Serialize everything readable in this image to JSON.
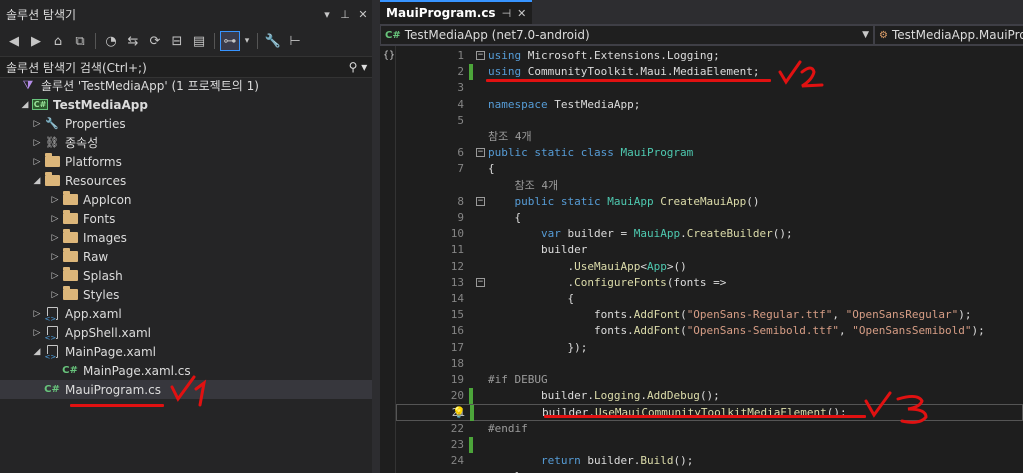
{
  "solution_explorer": {
    "title": "솔루션 탐색기",
    "search_placeholder": "솔루션 탐색기 검색(Ctrl+;)",
    "tree": [
      {
        "label": "솔루션 'TestMediaApp' (1 프로젝트의 1)",
        "icon": "solution-icon",
        "depth": 0,
        "arrow": ""
      },
      {
        "label": "TestMediaApp",
        "icon": "csproj-icon",
        "depth": 1,
        "arrow": "open",
        "bold": true
      },
      {
        "label": "Properties",
        "icon": "wrench-icon",
        "depth": 2,
        "arrow": "closed"
      },
      {
        "label": "종속성",
        "icon": "dependencies-icon",
        "depth": 2,
        "arrow": "closed"
      },
      {
        "label": "Platforms",
        "icon": "folder-icon",
        "depth": 2,
        "arrow": "closed"
      },
      {
        "label": "Resources",
        "icon": "folder-icon",
        "depth": 2,
        "arrow": "open"
      },
      {
        "label": "AppIcon",
        "icon": "folder-icon",
        "depth": 3,
        "arrow": "closed"
      },
      {
        "label": "Fonts",
        "icon": "folder-icon",
        "depth": 3,
        "arrow": "closed"
      },
      {
        "label": "Images",
        "icon": "folder-icon",
        "depth": 3,
        "arrow": "closed"
      },
      {
        "label": "Raw",
        "icon": "folder-icon",
        "depth": 3,
        "arrow": "closed"
      },
      {
        "label": "Splash",
        "icon": "folder-icon",
        "depth": 3,
        "arrow": "closed"
      },
      {
        "label": "Styles",
        "icon": "folder-icon",
        "depth": 3,
        "arrow": "closed"
      },
      {
        "label": "App.xaml",
        "icon": "xaml-icon",
        "depth": 2,
        "arrow": "closed"
      },
      {
        "label": "AppShell.xaml",
        "icon": "xaml-icon",
        "depth": 2,
        "arrow": "closed"
      },
      {
        "label": "MainPage.xaml",
        "icon": "xaml-icon",
        "depth": 2,
        "arrow": "open"
      },
      {
        "label": "MainPage.xaml.cs",
        "icon": "csharp-icon",
        "depth": 3,
        "arrow": ""
      },
      {
        "label": "MauiProgram.cs",
        "icon": "csharp-icon",
        "depth": 2,
        "arrow": "",
        "selected": true
      }
    ],
    "annotation": "✓1"
  },
  "editor": {
    "tab_label": "MauiProgram.cs",
    "nav_project": "TestMediaApp (net7.0-android)",
    "nav_class": "TestMediaApp.MauiProgram",
    "lines": [
      {
        "n": "1",
        "tokens": [
          [
            "kw",
            "using"
          ],
          [
            "tx",
            " Microsoft.Extensions.Logging;"
          ]
        ],
        "fold": "−"
      },
      {
        "n": "2",
        "tokens": [
          [
            "kw",
            "using"
          ],
          [
            "tx",
            " CommunityToolkit.Maui.MediaElement;"
          ]
        ],
        "change": true
      },
      {
        "n": "3",
        "tokens": []
      },
      {
        "n": "4",
        "tokens": [
          [
            "kw",
            "namespace"
          ],
          [
            "tx",
            " TestMediaApp;"
          ]
        ]
      },
      {
        "n": "5",
        "tokens": []
      },
      {
        "n": "",
        "tokens": [
          [
            "gr",
            "참조 4개"
          ]
        ]
      },
      {
        "n": "6",
        "tokens": [
          [
            "kw",
            "public static class "
          ],
          [
            "ty",
            "MauiProgram"
          ]
        ],
        "fold": "−"
      },
      {
        "n": "7",
        "tokens": [
          [
            "tx",
            "{"
          ]
        ]
      },
      {
        "n": "",
        "tokens": [
          [
            "gr",
            "    참조 4개"
          ]
        ]
      },
      {
        "n": "8",
        "tokens": [
          [
            "tx",
            "    "
          ],
          [
            "kw",
            "public static "
          ],
          [
            "ty",
            "MauiApp "
          ],
          [
            "mt",
            "CreateMauiApp"
          ],
          [
            "tx",
            "()"
          ]
        ],
        "fold": "−"
      },
      {
        "n": "9",
        "tokens": [
          [
            "tx",
            "    {"
          ]
        ]
      },
      {
        "n": "10",
        "tokens": [
          [
            "tx",
            "        "
          ],
          [
            "kw",
            "var"
          ],
          [
            "tx",
            " builder = "
          ],
          [
            "ty",
            "MauiApp"
          ],
          [
            "tx",
            "."
          ],
          [
            "mt",
            "CreateBuilder"
          ],
          [
            "tx",
            "();"
          ]
        ]
      },
      {
        "n": "11",
        "tokens": [
          [
            "tx",
            "        builder"
          ]
        ]
      },
      {
        "n": "12",
        "tokens": [
          [
            "tx",
            "            ."
          ],
          [
            "mt",
            "UseMauiApp"
          ],
          [
            "tx",
            "<"
          ],
          [
            "ty",
            "App"
          ],
          [
            "tx",
            ">()"
          ]
        ]
      },
      {
        "n": "13",
        "tokens": [
          [
            "tx",
            "            ."
          ],
          [
            "mt",
            "ConfigureFonts"
          ],
          [
            "tx",
            "(fonts =>"
          ]
        ],
        "fold": "−"
      },
      {
        "n": "14",
        "tokens": [
          [
            "tx",
            "            {"
          ]
        ]
      },
      {
        "n": "15",
        "tokens": [
          [
            "tx",
            "                fonts."
          ],
          [
            "mt",
            "AddFont"
          ],
          [
            "tx",
            "("
          ],
          [
            "st",
            "\"OpenSans-Regular.ttf\""
          ],
          [
            "tx",
            ", "
          ],
          [
            "st",
            "\"OpenSansRegular\""
          ],
          [
            "tx",
            ");"
          ]
        ]
      },
      {
        "n": "16",
        "tokens": [
          [
            "tx",
            "                fonts."
          ],
          [
            "mt",
            "AddFont"
          ],
          [
            "tx",
            "("
          ],
          [
            "st",
            "\"OpenSans-Semibold.ttf\""
          ],
          [
            "tx",
            ", "
          ],
          [
            "st",
            "\"OpenSansSemibold\""
          ],
          [
            "tx",
            ");"
          ]
        ]
      },
      {
        "n": "17",
        "tokens": [
          [
            "tx",
            "            });"
          ]
        ]
      },
      {
        "n": "18",
        "tokens": []
      },
      {
        "n": "19",
        "tokens": [
          [
            "pp",
            "#if DEBUG"
          ]
        ]
      },
      {
        "n": "20",
        "tokens": [
          [
            "tx",
            "        builder."
          ],
          [
            "mt",
            "Logging"
          ],
          [
            "tx",
            "."
          ],
          [
            "mt",
            "AddDebug"
          ],
          [
            "tx",
            "();"
          ]
        ],
        "change": true
      },
      {
        "n": "21",
        "tokens": [
          [
            "tx",
            "        builder."
          ],
          [
            "mt",
            "UseMauiCommunityToolkitMediaElement"
          ],
          [
            "tx",
            "();"
          ]
        ],
        "change": true,
        "current": true
      },
      {
        "n": "22",
        "tokens": [
          [
            "pp",
            "#endif"
          ]
        ]
      },
      {
        "n": "23",
        "tokens": [],
        "change": true
      },
      {
        "n": "24",
        "tokens": [
          [
            "tx",
            "        "
          ],
          [
            "kw",
            "return"
          ],
          [
            "tx",
            " builder."
          ],
          [
            "mt",
            "Build"
          ],
          [
            "tx",
            "();"
          ]
        ]
      },
      {
        "n": "",
        "tokens": [
          [
            "tx",
            "    }"
          ]
        ]
      }
    ],
    "annotation_2": "✓2",
    "annotation_3": "✓3"
  },
  "colors": {
    "accent": "#3794ff",
    "change_bar": "#4ca53a",
    "annotation_red": "#e11111"
  }
}
